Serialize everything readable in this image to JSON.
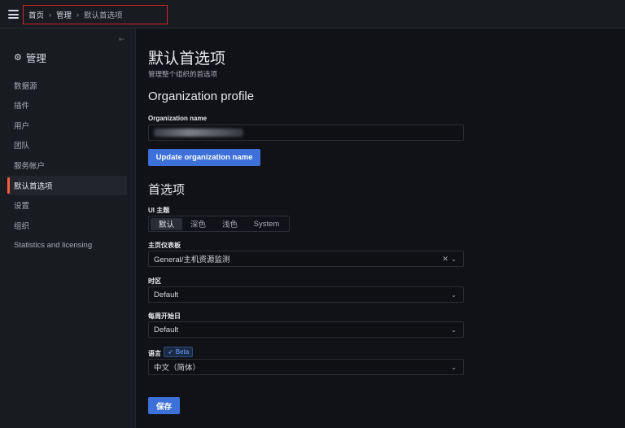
{
  "breadcrumb": {
    "home": "首页",
    "admin": "管理",
    "current": "默认首选项"
  },
  "sidebar": {
    "title": "管理",
    "items": [
      {
        "label": "数据源"
      },
      {
        "label": "插件"
      },
      {
        "label": "用户"
      },
      {
        "label": "团队"
      },
      {
        "label": "服务帐户"
      },
      {
        "label": "默认首选项",
        "active": true
      },
      {
        "label": "设置"
      },
      {
        "label": "组织"
      },
      {
        "label": "Statistics and licensing"
      }
    ]
  },
  "page": {
    "title": "默认首选项",
    "subtitle": "管理整个组织的首选项"
  },
  "org_profile": {
    "heading": "Organization profile",
    "name_label": "Organization name",
    "update_button": "Update organization name"
  },
  "prefs": {
    "heading": "首选项",
    "theme_label": "UI 主题",
    "theme_options": [
      "默认",
      "深色",
      "浅色",
      "System"
    ],
    "home_dashboard_label": "主页仪表板",
    "home_dashboard_value": "General/主机资源监测",
    "timezone_label": "时区",
    "timezone_value": "Default",
    "week_start_label": "每周开始日",
    "week_start_value": "Default",
    "language_label": "语言",
    "beta_badge": "Beta",
    "language_value": "中文（简体）",
    "save_button": "保存"
  },
  "colors": {
    "accent": "#3d71d9",
    "active_marker": "#f55f3e",
    "highlight_border": "#d4262c"
  }
}
